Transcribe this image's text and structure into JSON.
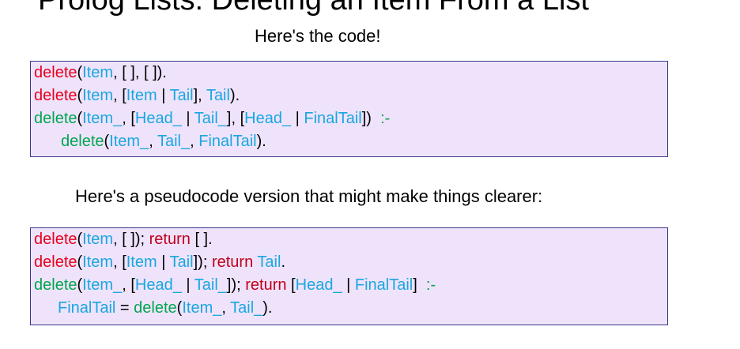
{
  "title": "Prolog Lists: Deleting an Item From a List",
  "caption_code": "Here's the code!",
  "caption_pseudo": "Here's a pseudocode version that might make things clearer:",
  "code": [
    [
      {
        "t": "delete",
        "c": "red"
      },
      {
        "t": "(",
        "c": "black"
      },
      {
        "t": "Item",
        "c": "blue"
      },
      {
        "t": ", [ ], [ ]).",
        "c": "black"
      }
    ],
    [
      {
        "t": "delete",
        "c": "red"
      },
      {
        "t": "(",
        "c": "black"
      },
      {
        "t": "Item",
        "c": "blue"
      },
      {
        "t": ", [",
        "c": "black"
      },
      {
        "t": "Item",
        "c": "blue"
      },
      {
        "t": " | ",
        "c": "black"
      },
      {
        "t": "Tail",
        "c": "blue"
      },
      {
        "t": "], ",
        "c": "black"
      },
      {
        "t": "Tail",
        "c": "blue"
      },
      {
        "t": ").",
        "c": "black"
      }
    ],
    [
      {
        "t": "delete",
        "c": "green"
      },
      {
        "t": "(",
        "c": "black"
      },
      {
        "t": "Item_",
        "c": "blue"
      },
      {
        "t": ", [",
        "c": "black"
      },
      {
        "t": "Head_",
        "c": "blue"
      },
      {
        "t": " | ",
        "c": "black"
      },
      {
        "t": "Tail_",
        "c": "blue"
      },
      {
        "t": "], [",
        "c": "black"
      },
      {
        "t": "Head_",
        "c": "blue"
      },
      {
        "t": " | ",
        "c": "black"
      },
      {
        "t": "FinalTail",
        "c": "blue"
      },
      {
        "t": "])  ",
        "c": "black"
      },
      {
        "t": ":-",
        "c": "green"
      }
    ],
    [
      {
        "t": "delete",
        "c": "green"
      },
      {
        "t": "(",
        "c": "black"
      },
      {
        "t": "Item_",
        "c": "blue"
      },
      {
        "t": ", ",
        "c": "black"
      },
      {
        "t": "Tail_",
        "c": "blue"
      },
      {
        "t": ", ",
        "c": "black"
      },
      {
        "t": "FinalTail",
        "c": "blue"
      },
      {
        "t": ").",
        "c": "black"
      }
    ]
  ],
  "pseudo": [
    [
      {
        "t": "delete",
        "c": "red"
      },
      {
        "t": "(",
        "c": "black"
      },
      {
        "t": "Item",
        "c": "blue"
      },
      {
        "t": ", [ ]); ",
        "c": "black"
      },
      {
        "t": "return",
        "c": "dred"
      },
      {
        "t": " [ ].",
        "c": "black"
      }
    ],
    [
      {
        "t": "delete",
        "c": "red"
      },
      {
        "t": "(",
        "c": "black"
      },
      {
        "t": "Item",
        "c": "blue"
      },
      {
        "t": ", [",
        "c": "black"
      },
      {
        "t": "Item",
        "c": "blue"
      },
      {
        "t": " | ",
        "c": "black"
      },
      {
        "t": "Tail",
        "c": "blue"
      },
      {
        "t": "]); ",
        "c": "black"
      },
      {
        "t": "return",
        "c": "dred"
      },
      {
        "t": " ",
        "c": "black"
      },
      {
        "t": "Tail",
        "c": "blue"
      },
      {
        "t": ".",
        "c": "black"
      }
    ],
    [
      {
        "t": "delete",
        "c": "green"
      },
      {
        "t": "(",
        "c": "black"
      },
      {
        "t": "Item_",
        "c": "blue"
      },
      {
        "t": ", [",
        "c": "black"
      },
      {
        "t": "Head_",
        "c": "blue"
      },
      {
        "t": " | ",
        "c": "black"
      },
      {
        "t": "Tail_",
        "c": "blue"
      },
      {
        "t": "]); ",
        "c": "black"
      },
      {
        "t": "return",
        "c": "dred"
      },
      {
        "t": " [",
        "c": "black"
      },
      {
        "t": "Head_",
        "c": "blue"
      },
      {
        "t": " | ",
        "c": "black"
      },
      {
        "t": "FinalTail",
        "c": "blue"
      },
      {
        "t": "]  ",
        "c": "black"
      },
      {
        "t": ":-",
        "c": "green"
      }
    ],
    [
      {
        "t": "FinalTail",
        "c": "blue"
      },
      {
        "t": " = ",
        "c": "black"
      },
      {
        "t": "delete",
        "c": "green"
      },
      {
        "t": "(",
        "c": "black"
      },
      {
        "t": "Item_",
        "c": "blue"
      },
      {
        "t": ", ",
        "c": "black"
      },
      {
        "t": "Tail_",
        "c": "blue"
      },
      {
        "t": ").",
        "c": "black"
      }
    ]
  ],
  "colors": {
    "red": "#e8001c",
    "dred": "#c0001a",
    "green": "#00a550",
    "blue": "#19a7e0",
    "black": "#000000",
    "box_background": "#efe3fb",
    "box_border": "#3a3a8a"
  }
}
